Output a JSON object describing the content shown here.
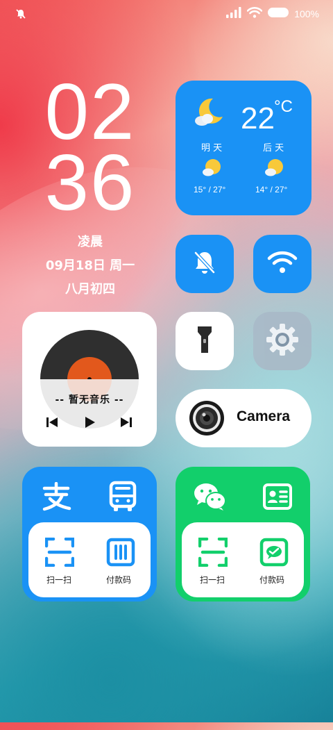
{
  "status_bar": {
    "battery": "100%"
  },
  "clock": {
    "hour": "02",
    "minute": "36"
  },
  "date": {
    "period": "凌晨",
    "date_weekday": "09月18日  周一",
    "lunar": "八月初四"
  },
  "weather": {
    "temperature": "22",
    "unit": "°C",
    "forecast": [
      {
        "label": "明 天",
        "range": "15° / 27°"
      },
      {
        "label": "后 天",
        "range": "14° / 27°"
      }
    ]
  },
  "music": {
    "now_playing": "-- 暂无音乐 --"
  },
  "camera": {
    "label": "Camera"
  },
  "alipay": {
    "scan_label": "扫一扫",
    "pay_label": "付款码"
  },
  "wechat": {
    "scan_label": "扫一扫",
    "pay_label": "付款码"
  },
  "colors": {
    "accent_blue": "#1a92f5",
    "wechat_green": "#12cf6b",
    "weather_sun": "#f8c93a"
  }
}
